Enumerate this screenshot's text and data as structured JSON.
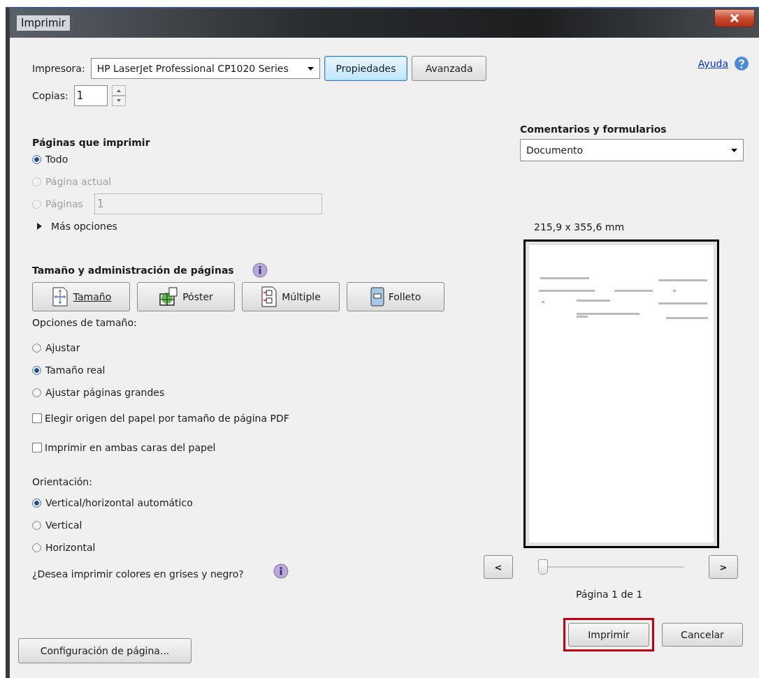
{
  "window": {
    "title": "Imprimir"
  },
  "printer": {
    "label": "Impresora:",
    "value": "HP LaserJet Professional CP1020 Series",
    "buttons": [
      {
        "label": "Propiedades",
        "focused": true
      },
      {
        "label": "Avanzada",
        "focused": false
      }
    ]
  },
  "copies": {
    "label": "Copias:",
    "value": "1"
  },
  "help": {
    "label": "Ayuda"
  },
  "pages_to_print": {
    "title": "Páginas que imprimir",
    "options": [
      {
        "label": "Todo",
        "selected": true,
        "disabled": false
      },
      {
        "label": "Página actual",
        "selected": false,
        "disabled": true
      },
      {
        "label": "Páginas",
        "selected": false,
        "disabled": true,
        "field_value": "1"
      }
    ],
    "more_options": {
      "label": "Más opciones",
      "expanded": false
    }
  },
  "page_sizing": {
    "title": "Tamaño y administración de páginas",
    "modes": [
      {
        "kind": "size",
        "label": "Tamaño",
        "selected": true
      },
      {
        "kind": "poster",
        "label": "Póster",
        "selected": false
      },
      {
        "kind": "multiple",
        "label": "Múltiple",
        "selected": false
      },
      {
        "kind": "booklet",
        "label": "Folleto",
        "selected": false
      }
    ],
    "size_options_label": "Opciones de tamaño:",
    "size_options": [
      {
        "label": "Ajustar",
        "selected": false
      },
      {
        "label": "Tamaño real",
        "selected": true
      },
      {
        "label": "Ajustar páginas grandes",
        "selected": false
      }
    ],
    "checkboxes": [
      {
        "label": "Elegir origen del papel por tamaño de página PDF",
        "checked": false
      },
      {
        "label": "Imprimir en ambas caras del papel",
        "checked": false
      }
    ]
  },
  "orientation": {
    "label": "Orientación:",
    "options": [
      {
        "label": "Vertical/horizontal automático",
        "selected": true
      },
      {
        "label": "Vertical",
        "selected": false
      },
      {
        "label": "Horizontal",
        "selected": false
      }
    ]
  },
  "grayscale": {
    "label": "¿Desea imprimir colores en grises y negro?"
  },
  "comments_forms": {
    "title": "Comentarios y formularios",
    "value": "Documento"
  },
  "preview": {
    "dimensions": "215,9 x 355,6 mm",
    "prev": "<",
    "next": ">",
    "slider": {
      "level": 0
    },
    "page_label": "Página 1 de 1"
  },
  "page_setup_button": "Configuración de página...",
  "actions": [
    {
      "label": "Imprimir",
      "highlighted": true
    },
    {
      "label": "Cancelar",
      "highlighted": false
    }
  ]
}
